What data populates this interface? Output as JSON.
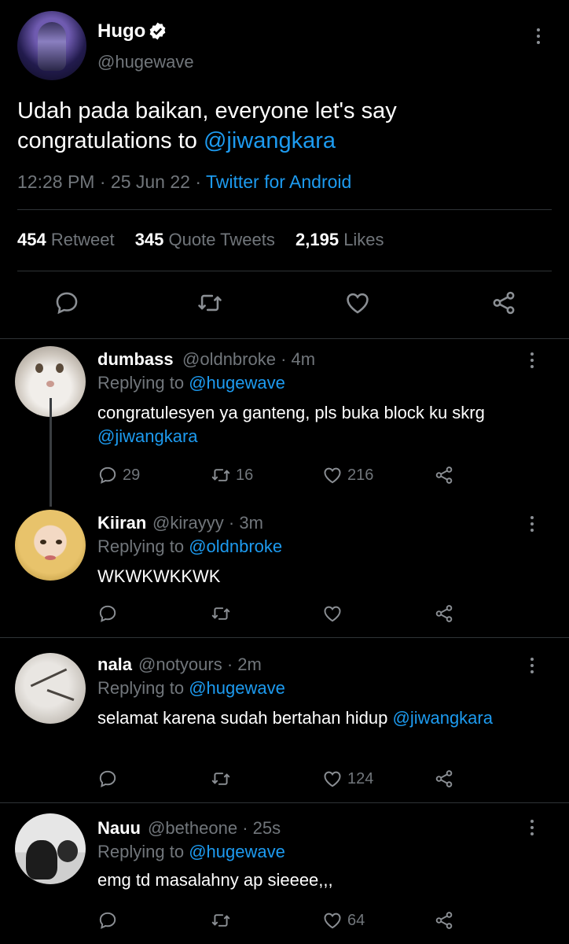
{
  "main_tweet": {
    "name": "Hugo",
    "handle": "@hugewave",
    "text": "Udah pada baikan, everyone let's say congratulations to ",
    "mention": "@jiwangkara",
    "time": "12:28 PM",
    "sep1": " · ",
    "date": "25 Jun 22",
    "sep2": " · ",
    "source": "Twitter for Android",
    "stats": {
      "retweets": "454",
      "retweets_label": "Retweet",
      "quotes": "345",
      "quotes_label": "Quote Tweets",
      "likes": "2,195",
      "likes_label": "Likes"
    },
    "actions": [
      "reply-icon",
      "retweet-icon",
      "like-icon",
      "share-icon"
    ]
  },
  "replies": [
    {
      "name": "dumbass",
      "handle": "@oldnbroke · 4m",
      "replying_prefix": "Replying to ",
      "replying_to": "@hugewave",
      "text": "congratulesyen ya ganteng, pls buka block ku skrg ",
      "mention": "@jiwangkara",
      "replies": "29",
      "retweets": "16",
      "likes": "216"
    },
    {
      "name": "Kiiran",
      "handle": "@kirayyy · 3m",
      "replying_prefix": "Replying to ",
      "replying_to": "@oldnbroke",
      "text": "WKWKWKKWK",
      "mention": "",
      "replies": "",
      "retweets": "",
      "likes": ""
    },
    {
      "name": "nala",
      "handle": "@notyours · 2m",
      "replying_prefix": "Replying to ",
      "replying_to": "@hugewave",
      "text": "selamat karena sudah bertahan hidup ",
      "mention": "@jiwangkara",
      "replies": "",
      "retweets": "",
      "likes": "124"
    },
    {
      "name": "Nauu",
      "handle": "@betheone · 25s",
      "replying_prefix": "Replying to ",
      "replying_to": "@hugewave",
      "text": "emg td masalahny ap sieeee,,,",
      "mention": "",
      "replies": "",
      "retweets": "",
      "likes": "64"
    }
  ],
  "colors": {
    "accent": "#1d9bf0",
    "muted": "#71767b",
    "background": "#000000"
  }
}
